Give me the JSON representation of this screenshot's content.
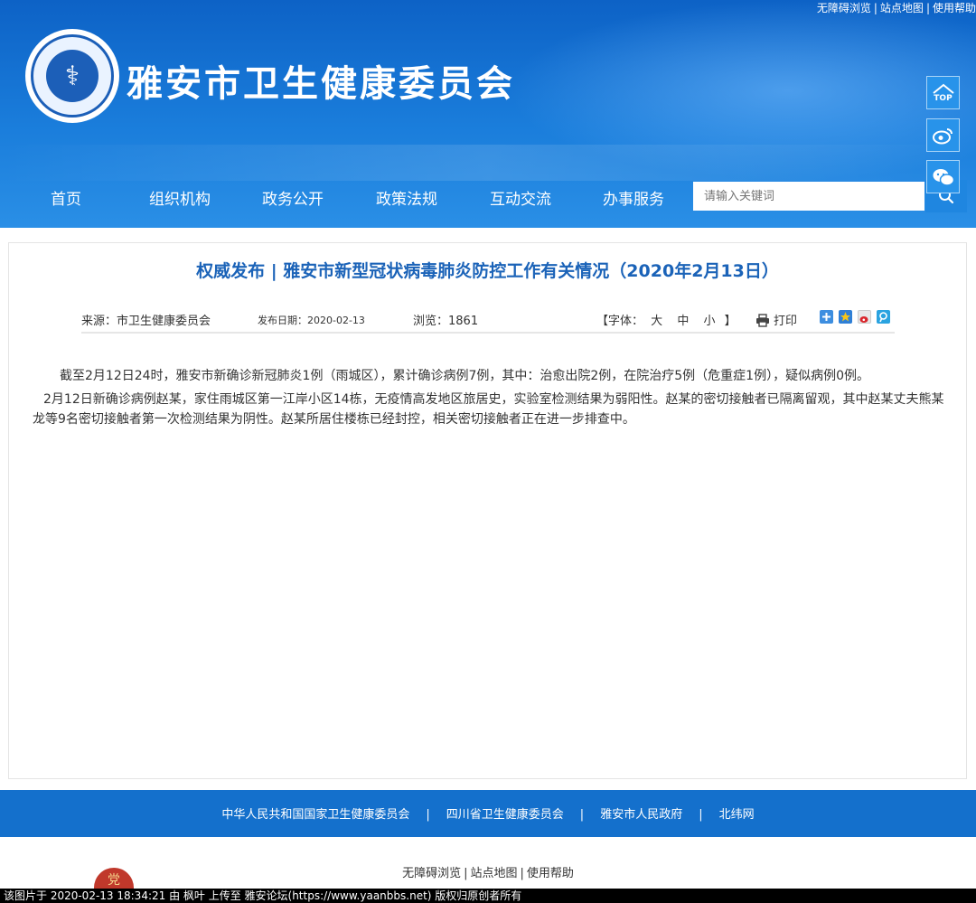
{
  "header": {
    "top_links": [
      "无障碍浏览",
      "站点地图",
      "使用帮助"
    ],
    "top_sep": "|",
    "site_title": "雅安市卫生健康委员会",
    "nav": [
      "首页",
      "组织机构",
      "政务公开",
      "政策法规",
      "互动交流",
      "办事服务"
    ],
    "search_placeholder": "请输入关键词",
    "side_buttons": {
      "top_label": "TOP"
    }
  },
  "article": {
    "title": "权威发布 | 雅安市新型冠状病毒肺炎防控工作有关情况（2020年2月13日）",
    "source": "来源：市卫生健康委员会",
    "publish_date": "发布日期：2020-02-13",
    "views": "浏览：1861",
    "font_size_label": "【字体：",
    "font_large": "大",
    "font_medium": "中",
    "font_small": "小",
    "font_size_end": "】",
    "print_label": "打印",
    "paragraphs": [
      "截至2月12日24时，雅安市新确诊新冠肺炎1例（雨城区），累计确诊病例7例，其中：治愈出院2例，在院治疗5例（危重症1例），疑似病例0例。",
      "2月12日新确诊病例赵某，家住雨城区第一江岸小区14栋，无疫情高发地区旅居史，实验室检测结果为弱阳性。赵某的密切接触者已隔离留观，其中赵某丈夫熊某龙等9名密切接触者第一次检测结果为阴性。赵某所居住楼栋已经封控，相关密切接触者正在进一步排查中。"
    ]
  },
  "footer": {
    "links": [
      "中华人民共和国国家卫生健康委员会",
      "四川省卫生健康委员会",
      "雅安市人民政府",
      "北纬网"
    ],
    "links_sep": "|",
    "bottom_links": [
      "无障碍浏览",
      "站点地图",
      "使用帮助"
    ],
    "bottom_sep": "|",
    "watermark": "该图片于 2020-02-13 18:34:21 由 枫叶 上传至 雅安论坛(https://www.yaanbbs.net) 版权归原创者所有"
  },
  "colors": {
    "header_blue": "#1a7ddb",
    "title_blue": "#1b63b8",
    "footer_blue": "#1470cc"
  }
}
